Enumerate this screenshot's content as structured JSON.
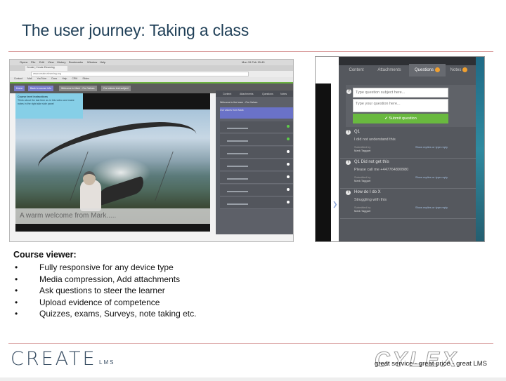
{
  "slide": {
    "title": "The user journey:   Taking a class",
    "section_heading": "Course viewer:",
    "bullet_symbol": "•",
    "bullets": [
      "Fully responsive for any device type",
      "Media compression, Add attachments",
      "Ask questions to steer the learner",
      "Upload evidence of competence",
      "Quizzes, exams, Surveys, note taking etc."
    ]
  },
  "course_viewer": {
    "menu": [
      "Opera",
      "File",
      "Edit",
      "View",
      "History",
      "Bookmarks",
      "Window",
      "Help"
    ],
    "clock": "Mon 15 Feb  15:40",
    "tab_label": "Create | Create Elearning",
    "url": "www.create-elearning.org",
    "bookmarks": [
      "Contact",
      "Mail",
      "YouTube",
      "Docs",
      "Help",
      "CRM",
      "Slides"
    ],
    "toolbar_buttons": [
      "Home",
      "Back to course info",
      "Welcome to Mark - Our Values",
      "Our values test subject"
    ],
    "instructions_heading": "Course level instructions",
    "instructions_text": "Think about the last time as in this video and make notes in the right side side panel",
    "video_caption": "A warm welcome from Mark.....",
    "side_tabs": [
      "Content",
      "Attachments",
      "Questions",
      "Notes"
    ],
    "side_heading": "Welcome to the team - Our Values",
    "side_active_item": "Our values from Mark"
  },
  "questions_panel": {
    "tabs": [
      "Content",
      "Attachments",
      "Questions",
      "Notes"
    ],
    "active_tab": "Questions",
    "subject_placeholder": "Type question subject here...",
    "question_placeholder": "Type your question here...",
    "submit_label": "✔ Submit question",
    "items": [
      {
        "title": "Q1",
        "body": "I did not understand this",
        "submitted_label": "Submitted by",
        "author": "Mark Taggart",
        "reply_link": "Show replies or type reply"
      },
      {
        "title": "Q1 Did not get this",
        "body": "Please call me +447764890980",
        "submitted_label": "Submitted by",
        "author": "Mark Taggart",
        "reply_link": "Show replies or type reply"
      },
      {
        "title": "How do I do X",
        "body": "Struggling with this",
        "submitted_label": "Submitted by",
        "author": "Mark Taggart",
        "reply_link": "Show replies or type reply"
      }
    ]
  },
  "footer": {
    "logo_main": "CREATE",
    "logo_suffix": "LMS",
    "partner_logo": "CYLEX",
    "tagline": "great service - great price - great LMS"
  },
  "colors": {
    "title": "#1f3f57",
    "rule": "#d89a9a",
    "submit_green": "#69b93f",
    "instructions_blue": "#86cfe7"
  }
}
